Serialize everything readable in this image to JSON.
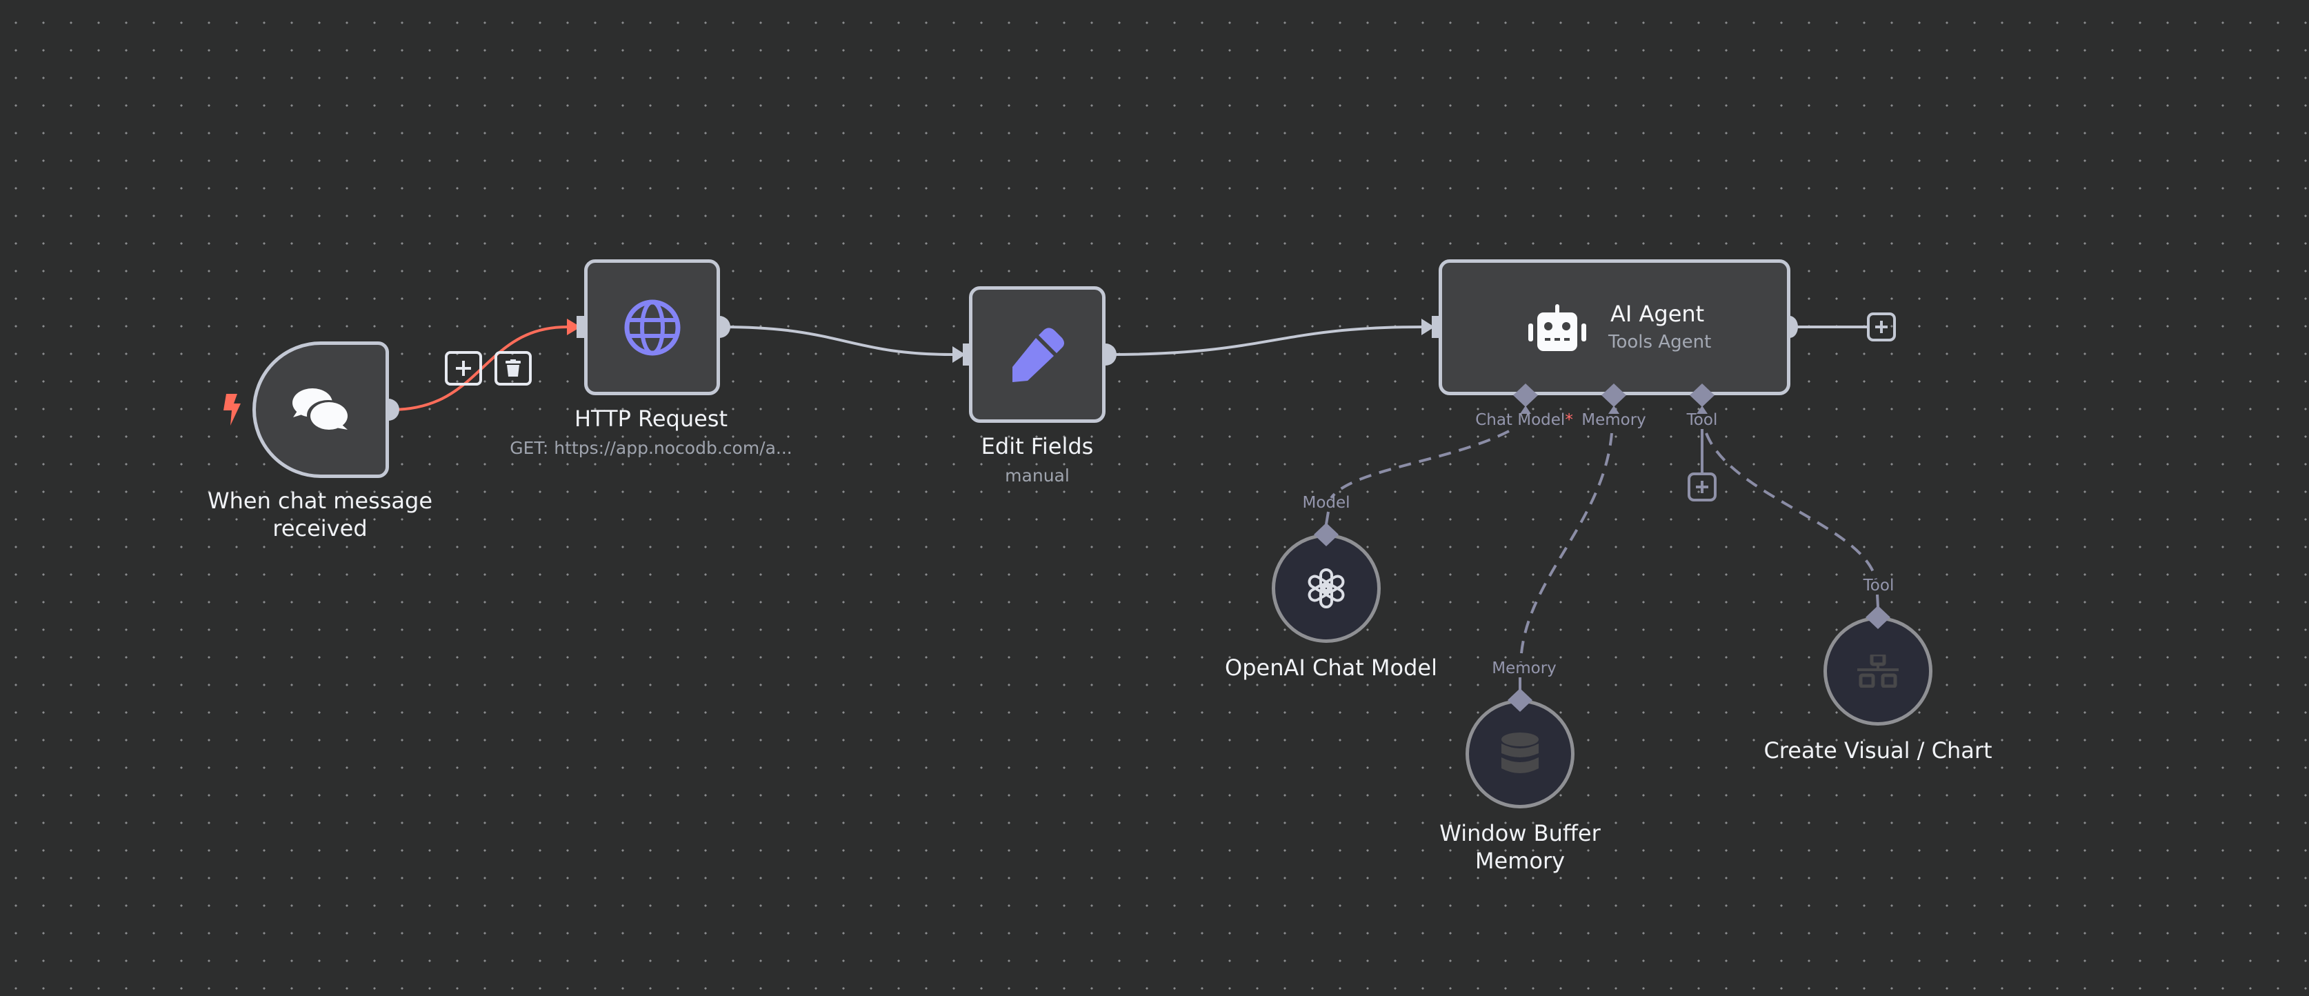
{
  "canvas": {
    "background": "#2d2e2e",
    "grid_dot_color": "#8a8c8e"
  },
  "colors": {
    "node_border": "#c3c8d4",
    "node_fill": "#414244",
    "sub_node_fill": "#2a2c38",
    "sub_node_border": "#8f9094",
    "accent_purple": "#8484f5",
    "trigger_red": "#ff6d5a",
    "port_gray": "#8b8da6",
    "required_star": "#ff6b6b"
  },
  "nodes": {
    "trigger": {
      "label_line1": "When chat message",
      "label_line2": "received",
      "icon": "chat-bubbles-icon",
      "badge_icon": "lightning-bolt-icon"
    },
    "http": {
      "label": "HTTP Request",
      "subtitle": "GET: https://app.nocodb.com/a...",
      "icon": "globe-icon"
    },
    "edit": {
      "label": "Edit Fields",
      "subtitle": "manual",
      "icon": "pencil-icon"
    },
    "agent": {
      "label": "AI Agent",
      "subtitle": "Tools Agent",
      "icon": "robot-icon",
      "ports": {
        "chat_model": "Chat Model",
        "chat_model_required": "*",
        "memory": "Memory",
        "tool": "Tool"
      }
    },
    "openai": {
      "label": "OpenAI Chat Model",
      "port_label": "Model",
      "icon": "openai-logo-icon"
    },
    "memory": {
      "label_line1": "Window Buffer",
      "label_line2": "Memory",
      "port_label": "Memory",
      "icon": "database-icon"
    },
    "tool": {
      "label": "Create Visual / Chart",
      "port_label": "Tool",
      "icon": "sitemap-icon"
    }
  },
  "edge_actions": {
    "add_label": "+",
    "delete_label": "delete"
  }
}
